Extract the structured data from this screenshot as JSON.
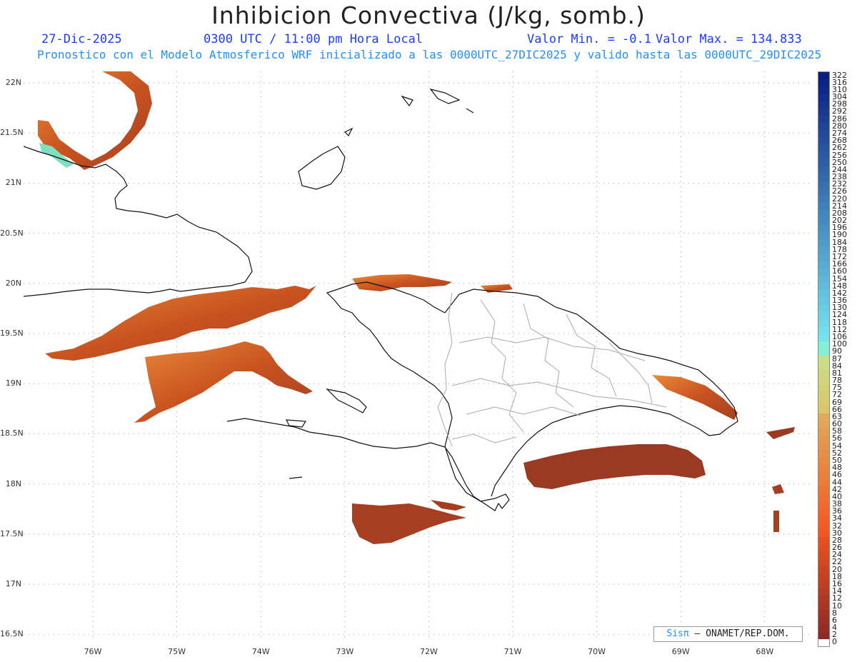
{
  "header": {
    "title": "Inhibicion Convectiva (J/kg, somb.)",
    "date": "27-Dic-2025",
    "time": "0300 UTC / 11:00 pm Hora Local",
    "min_label": "Valor Min. = -0.1",
    "max_label": "Valor Max. = 134.833",
    "subtitle": "Pronostico con el Modelo Atmosferico WRF inicializado a las 0000UTC_27DIC2025 y valido hasta las  0000UTC_29DIC2025"
  },
  "map": {
    "lat_labels": [
      "22N",
      "21.5N",
      "21N",
      "20.5N",
      "20N",
      "19.5N",
      "19N",
      "18.5N",
      "18N",
      "17.5N",
      "17N",
      "16.5N"
    ],
    "lon_labels": [
      "76W",
      "75W",
      "74W",
      "73W",
      "72W",
      "71W",
      "70W",
      "69W",
      "68W"
    ],
    "colors": {
      "coast": "#111111",
      "province_border": "#aaaaaa",
      "grid": "#888888",
      "field_dark": "#9b3a22",
      "field_mid": "#c44a1c",
      "field_light": "#e07a2a",
      "field_high": "#7ee0c0"
    }
  },
  "colorbar": {
    "labels": [
      "322",
      "316",
      "310",
      "304",
      "298",
      "292",
      "286",
      "280",
      "274",
      "268",
      "262",
      "256",
      "250",
      "244",
      "238",
      "232",
      "226",
      "220",
      "214",
      "208",
      "202",
      "196",
      "190",
      "184",
      "178",
      "172",
      "166",
      "160",
      "154",
      "148",
      "142",
      "136",
      "130",
      "124",
      "118",
      "112",
      "106",
      "100",
      "90",
      "87",
      "84",
      "81",
      "78",
      "75",
      "72",
      "69",
      "66",
      "63",
      "60",
      "58",
      "56",
      "54",
      "52",
      "50",
      "48",
      "46",
      "44",
      "42",
      "40",
      "38",
      "36",
      "34",
      "32",
      "30",
      "28",
      "26",
      "24",
      "22",
      "20",
      "18",
      "16",
      "14",
      "12",
      "10",
      "8",
      "6",
      "4",
      "2",
      "0"
    ]
  },
  "credit": {
    "brand": "Sisπ",
    "text": "– ONAMET/REP.DOM."
  }
}
